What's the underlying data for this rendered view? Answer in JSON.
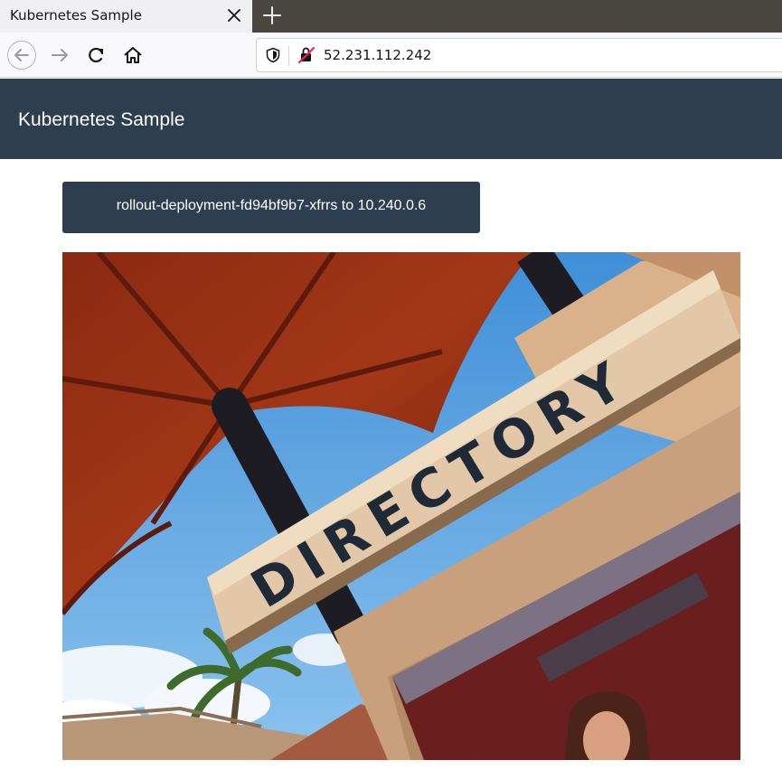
{
  "browser": {
    "tab_title": "Kubernetes Sample",
    "url": "52.231.112.242",
    "icons": {
      "tab_close": "close-icon",
      "new_tab": "plus-icon",
      "back": "back-arrow-icon",
      "forward": "forward-arrow-icon",
      "reload": "reload-icon",
      "home": "home-icon",
      "tracking": "shield-icon",
      "insecure": "insecure-connection-icon"
    }
  },
  "page": {
    "header_title": "Kubernetes Sample",
    "pod_info": "rollout-deployment-fd94bf9b7-xfrrs to 10.240.0.6",
    "photo_sign_text": "DIRECTORY"
  },
  "colors": {
    "header_bg": "#2c3e50",
    "badge_bg": "#2c3e50",
    "tabstrip_bg": "#4a4640"
  }
}
